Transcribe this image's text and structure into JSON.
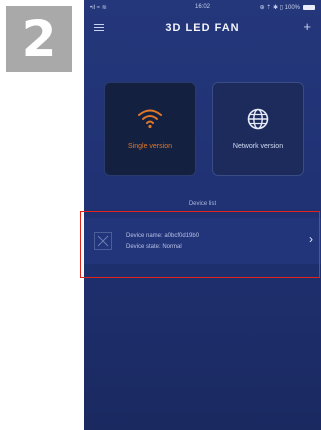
{
  "step": "2",
  "status_bar": {
    "left": "•ıl ≈ ≋",
    "time": "16:02",
    "right": "⊕ ⇡ ✱ ▯ 100%"
  },
  "app": {
    "title": "3D LED FAN"
  },
  "modes": {
    "single": {
      "label": "Single version",
      "icon": "wifi-icon",
      "color": "#e0782a"
    },
    "network": {
      "label": "Network version",
      "icon": "globe-icon"
    }
  },
  "device_list": {
    "title": "Device list",
    "device": {
      "name": "Device name: a0bcf0d19b0",
      "state": "Device state: Normal"
    }
  },
  "colors": {
    "highlight": "#e2231a",
    "background": "#203274"
  }
}
